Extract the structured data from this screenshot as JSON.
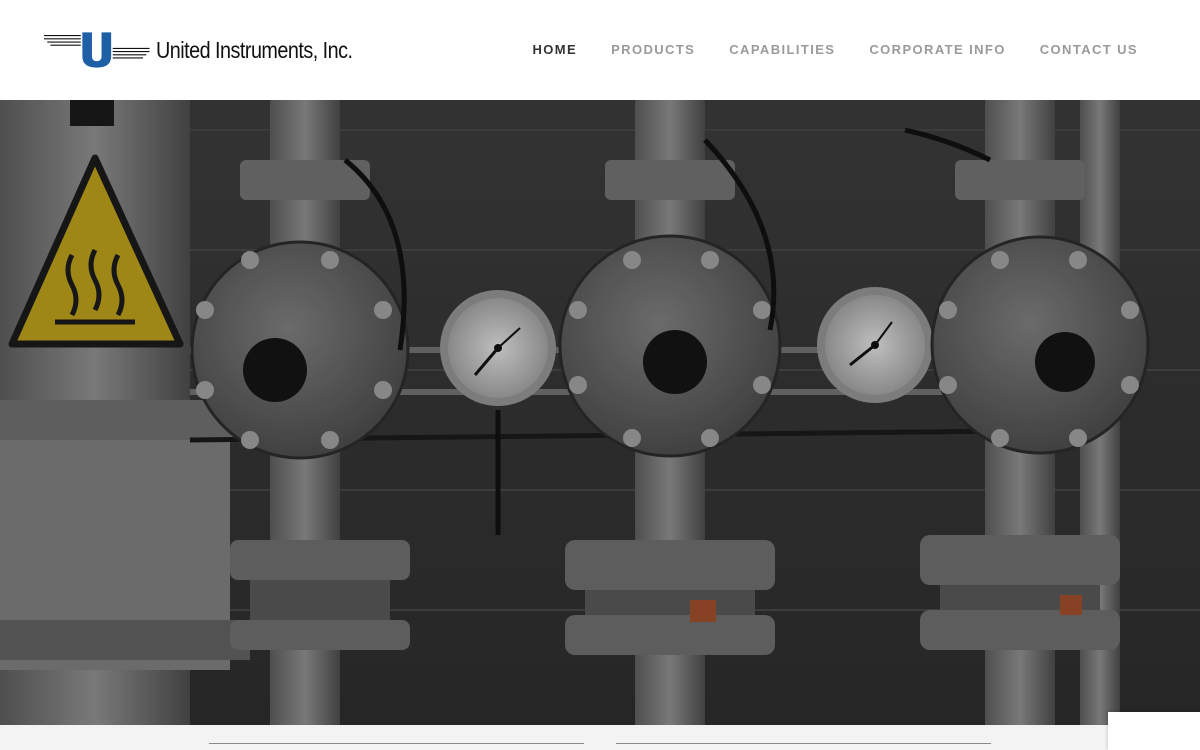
{
  "brand": {
    "name": "United Instruments, Inc.",
    "logo_letter": "U",
    "colors": {
      "accent": "#1f5fa6",
      "text": "#111111"
    }
  },
  "nav": {
    "items": [
      {
        "label": "HOME",
        "active": true
      },
      {
        "label": "PRODUCTS",
        "active": false
      },
      {
        "label": "CAPABILITIES",
        "active": false
      },
      {
        "label": "CORPORATE INFO",
        "active": false
      },
      {
        "label": "CONTACT US",
        "active": false
      }
    ],
    "colors": {
      "active": "#333333",
      "inactive": "#9a9a9a"
    }
  },
  "hero": {
    "image_subject": "industrial-pressure-regulators-with-gauges",
    "icons": [
      "hot-surface-warning-icon"
    ]
  }
}
